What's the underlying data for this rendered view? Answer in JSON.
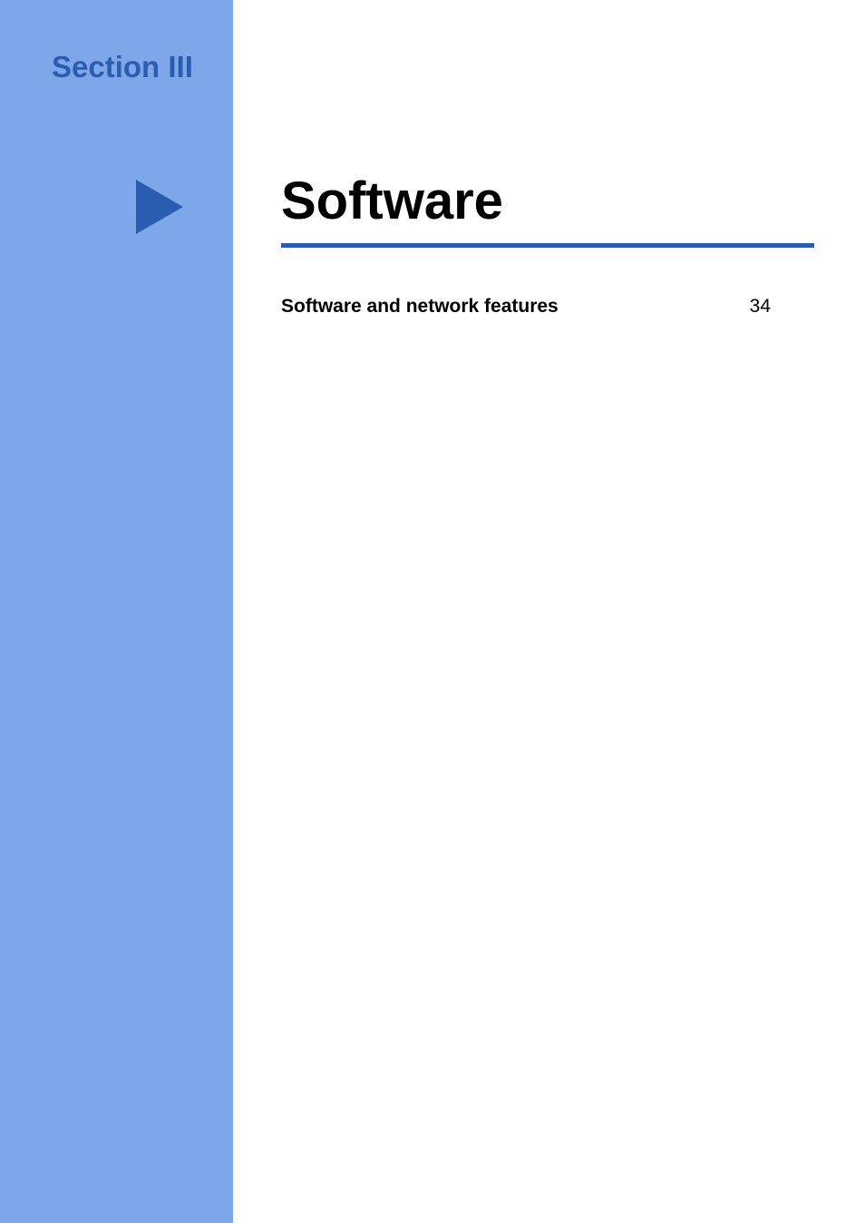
{
  "section": {
    "label": "Section III",
    "title": "Software"
  },
  "toc": {
    "items": [
      {
        "label": "Software and network features",
        "page": "34"
      }
    ]
  }
}
